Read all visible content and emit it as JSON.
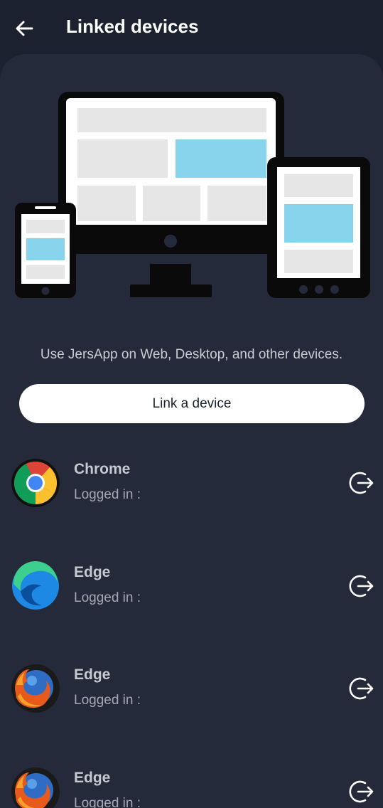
{
  "header": {
    "title": "Linked devices",
    "back_icon": "arrow-left-icon"
  },
  "hero": {
    "illustration": "devices-illustration",
    "subtitle": "Use JersApp on Web, Desktop, and other devices."
  },
  "actions": {
    "link_label": "Link a device"
  },
  "devices": [
    {
      "name": "Chrome",
      "status": "Logged in :",
      "icon": "chrome-icon"
    },
    {
      "name": "Edge",
      "status": "Logged in :",
      "icon": "edge-icon"
    },
    {
      "name": "Edge",
      "status": "Logged in :",
      "icon": "firefox-icon"
    },
    {
      "name": "Edge",
      "status": "Logged in :",
      "icon": "firefox-icon"
    }
  ],
  "colors": {
    "background": "#1c2130",
    "panel": "#252a3a",
    "accent_blue": "#87d4ec",
    "screen_gray": "#e6e6e6"
  }
}
